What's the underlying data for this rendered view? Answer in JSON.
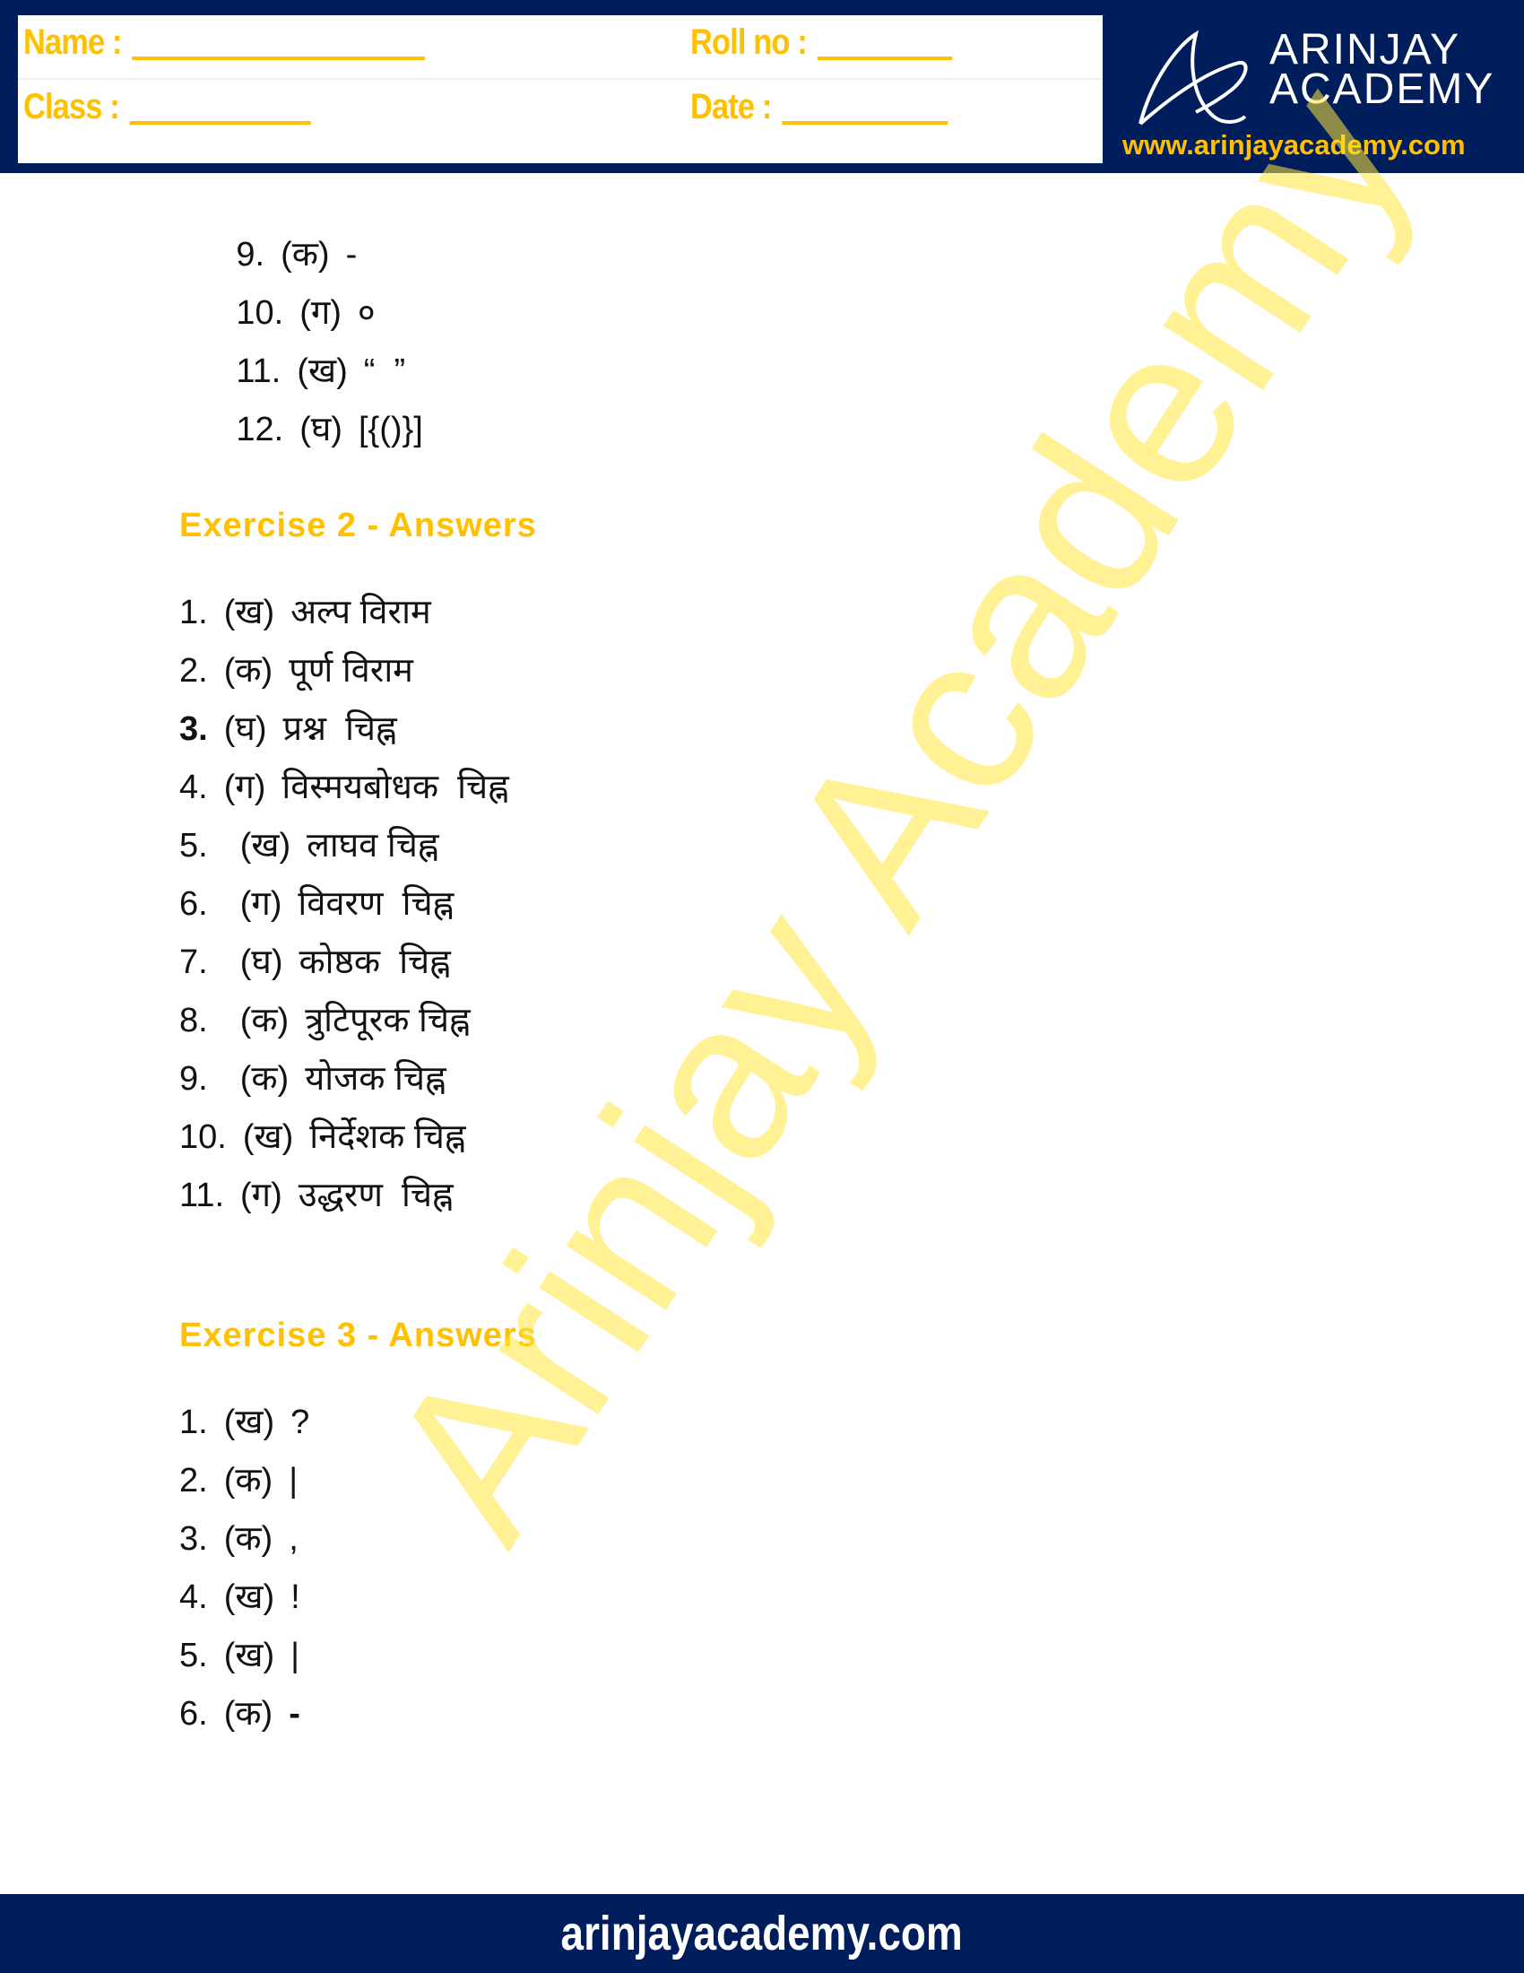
{
  "header": {
    "fields": {
      "name_label": "Name :",
      "roll_label": "Roll no :",
      "class_label": "Class :",
      "date_label": "Date :"
    },
    "brand": {
      "name_line1": "ARINJAY",
      "name_line2": "ACADEMY",
      "url": "www.arinjayacademy.com",
      "logo_icon": "arinjay-logo-icon"
    }
  },
  "exercise1_continued": [
    {
      "num": "9.",
      "option": "(क)",
      "answer": "-"
    },
    {
      "num": "10.",
      "option": "(ग)",
      "answer": "०"
    },
    {
      "num": "11.",
      "option": "(ख)",
      "answer": "“  ”"
    },
    {
      "num": "12.",
      "option": "(घ)",
      "answer": "[{()}]"
    }
  ],
  "exercise2": {
    "heading": "Exercise  2  -  Answers",
    "items": [
      {
        "num": "1.",
        "option": "(ख)",
        "answer": "अल्प विराम"
      },
      {
        "num": "2.",
        "option": "(क)",
        "answer": "पूर्ण विराम"
      },
      {
        "num": "3.",
        "option": "(घ)",
        "answer": "प्रश्न  चिह्न"
      },
      {
        "num": "4.",
        "option": "(ग)",
        "answer": "विस्मयबोधक  चिह्न"
      },
      {
        "num": "5.",
        "option": "(ख)",
        "answer": "लाघव चिह्न"
      },
      {
        "num": "6.",
        "option": "(ग)",
        "answer": "विवरण  चिह्न"
      },
      {
        "num": "7.",
        "option": "(घ)",
        "answer": "कोष्ठक  चिह्न"
      },
      {
        "num": "8.",
        "option": "(क)",
        "answer": "त्रुटिपूरक चिह्न"
      },
      {
        "num": "9.",
        "option": "(क)",
        "answer": "योजक चिह्न"
      },
      {
        "num": "10.",
        "option": "(ख)",
        "answer": "निर्देशक चिह्न"
      },
      {
        "num": "11.",
        "option": "(ग)",
        "answer": "उद्धरण  चिह्न"
      }
    ]
  },
  "exercise3": {
    "heading": "Exercise  3  -  Answers",
    "items": [
      {
        "num": "1.",
        "option": "(ख)",
        "answer": "?"
      },
      {
        "num": "2.",
        "option": "(क)",
        "answer": "|"
      },
      {
        "num": "3.",
        "option": "(क)",
        "answer": ","
      },
      {
        "num": "4.",
        "option": "(ख)",
        "answer": "!"
      },
      {
        "num": "5.",
        "option": "(ख)",
        "answer": "|"
      },
      {
        "num": "6.",
        "option": "(क)",
        "answer": "-"
      }
    ]
  },
  "watermark": "Arinjay Academy",
  "footer": {
    "url": "arinjayacademy.com"
  },
  "colors": {
    "navy": "#011e5c",
    "accent": "#ffc000",
    "watermark": "#ffe63c"
  }
}
